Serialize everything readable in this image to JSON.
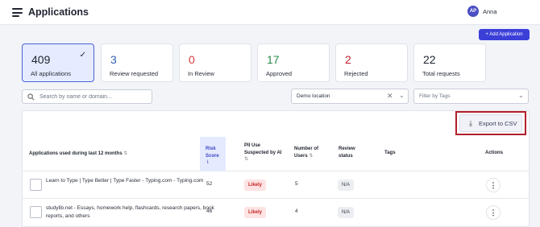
{
  "header": {
    "title": "Applications",
    "user": {
      "initials": "AP",
      "name": "Anna"
    }
  },
  "add_button_label": "+ Add Application",
  "summary_cards": [
    {
      "count": "409",
      "label": "All applications",
      "active": true
    },
    {
      "count": "3",
      "label": "Review requested",
      "color": "#2f5fb3"
    },
    {
      "count": "0",
      "label": "In Review",
      "color": "#d63a3a"
    },
    {
      "count": "17",
      "label": "Approved",
      "color": "#2e8a4a"
    },
    {
      "count": "2",
      "label": "Rejected",
      "color": "#c21f2c"
    },
    {
      "count": "22",
      "label": "Total requests",
      "color": "#1f2430"
    }
  ],
  "filters": {
    "search_placeholder": "Search by name or domain...",
    "location_value": "Demo location",
    "tags_placeholder": "Filter by Tags"
  },
  "export_label": "Export to CSV",
  "table": {
    "headers": {
      "app": "Applications used during last 12 months",
      "risk": "Risk Score",
      "pii": "PII Use Suspected by AI",
      "users": "Number of Users",
      "review": "Review status",
      "tags": "Tags",
      "actions": "Actions"
    },
    "rows": [
      {
        "app": "Learn to Type | Type Better | Type Faster - Typing.com - Typing.com",
        "risk": "52",
        "pii": "Likely",
        "users": "5",
        "review": "N/A"
      },
      {
        "app": "studylib.net - Essays, homework help, flashcards, research papers, book reports, and others",
        "risk": "46",
        "pii": "Likely",
        "users": "4",
        "review": "N/A"
      }
    ]
  },
  "colors": {
    "accent": "#3b3fd8",
    "highlight_box": "#b11e2b"
  }
}
